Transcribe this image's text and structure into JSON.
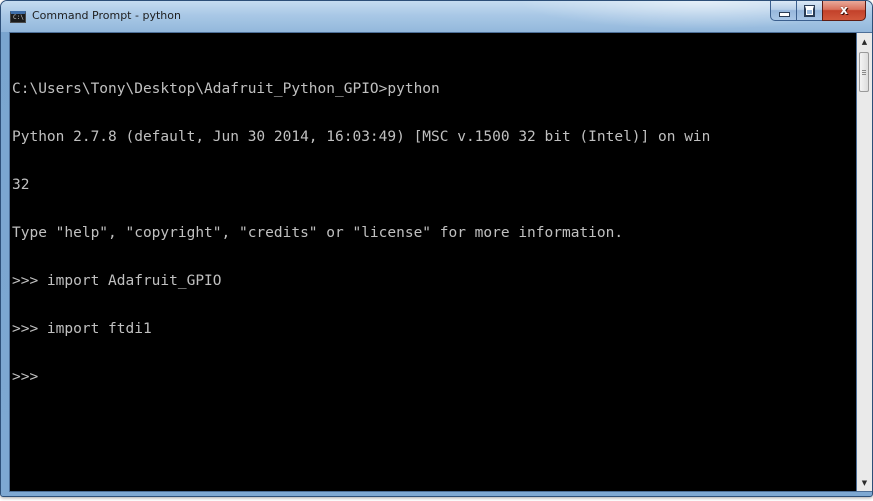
{
  "window": {
    "title": "Command Prompt - python"
  },
  "caption_buttons": {
    "minimize_icon": "minimize-icon",
    "maximize_icon": "maximize-icon",
    "close_icon": "close-icon",
    "close_glyph": "x"
  },
  "console": {
    "background": "#000000",
    "foreground": "#c0c0c0",
    "lines": [
      "C:\\Users\\Tony\\Desktop\\Adafruit_Python_GPIO>python",
      "Python 2.7.8 (default, Jun 30 2014, 16:03:49) [MSC v.1500 32 bit (Intel)] on win",
      "32",
      "Type \"help\", \"copyright\", \"credits\" or \"license\" for more information.",
      ">>> import Adafruit_GPIO",
      ">>> import ftdi1",
      ">>>"
    ]
  },
  "scrollbar": {
    "up_arrow": "▲",
    "down_arrow": "▼"
  }
}
